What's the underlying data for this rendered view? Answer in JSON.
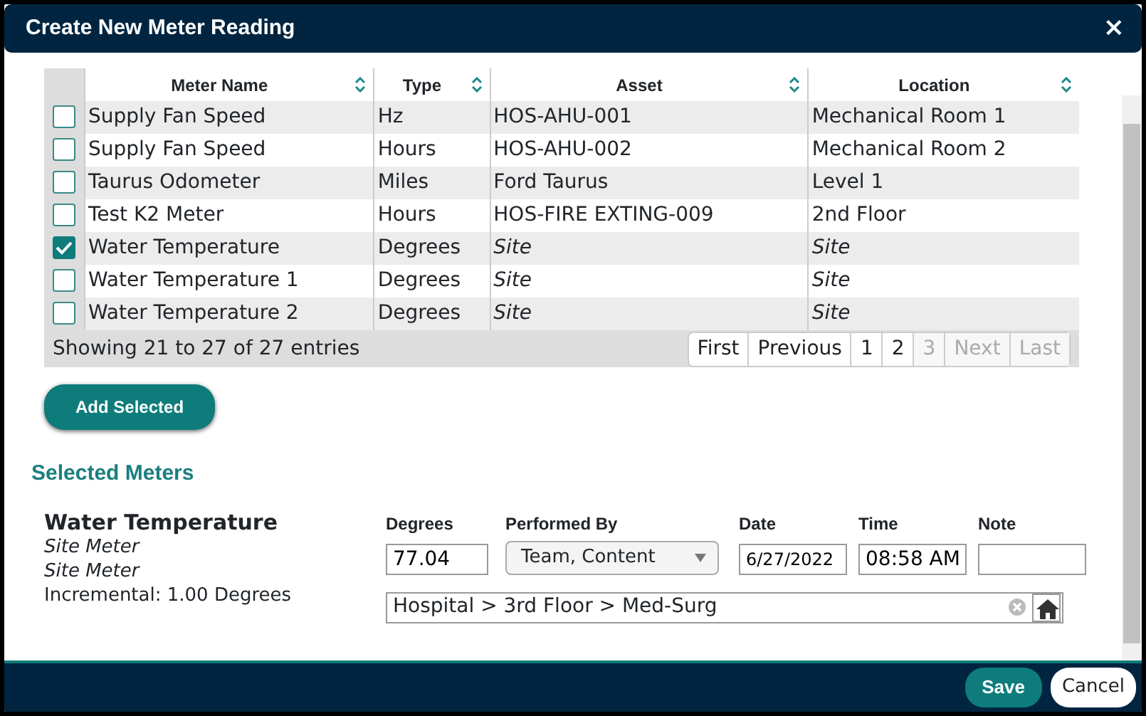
{
  "window": {
    "title": "Create New Meter Reading",
    "close": "×"
  },
  "table": {
    "columns": [
      "Meter Name",
      "Type",
      "Asset",
      "Location"
    ],
    "rows": [
      {
        "checked": false,
        "kind": "asset",
        "cells": [
          "Supply Fan Speed",
          "Hz",
          "HOS-AHU-001",
          "Mechanical Room 1"
        ]
      },
      {
        "checked": false,
        "kind": "asset",
        "cells": [
          "Supply Fan Speed",
          "Hours",
          "HOS-AHU-002",
          "Mechanical Room 2"
        ]
      },
      {
        "checked": false,
        "kind": "asset",
        "cells": [
          "Taurus Odometer",
          "Miles",
          "Ford Taurus",
          "Level 1"
        ]
      },
      {
        "checked": false,
        "kind": "asset",
        "cells": [
          "Test K2 Meter",
          "Hours",
          "HOS-FIRE EXTING-009",
          "2nd Floor"
        ]
      },
      {
        "checked": true,
        "kind": "site",
        "cells": [
          "Water Temperature",
          "Degrees",
          "Site",
          "Site"
        ]
      },
      {
        "checked": false,
        "kind": "site",
        "cells": [
          "Water Temperature 1",
          "Degrees",
          "Site",
          "Site"
        ]
      },
      {
        "checked": false,
        "kind": "site",
        "cells": [
          "Water Temperature 2",
          "Degrees",
          "Site",
          "Site"
        ]
      }
    ],
    "info": "Showing 21 to 27 of 27 entries",
    "pages": [
      {
        "label": "First",
        "disabled": false
      },
      {
        "label": "Previous",
        "disabled": false
      },
      {
        "label": "1",
        "disabled": false
      },
      {
        "label": "2",
        "disabled": false
      },
      {
        "label": "3",
        "disabled": true
      },
      {
        "label": "Next",
        "disabled": true
      },
      {
        "label": "Last",
        "disabled": true
      }
    ]
  },
  "add_button": "Add Selected",
  "selected_meters": {
    "heading": "Selected Meters",
    "meter": {
      "name": "Water Temperature",
      "lines": [
        "Site Meter",
        "Site Meter"
      ],
      "incremental": "Incremental: 1.00 Degrees"
    },
    "fields": {
      "degrees": {
        "label": "Degrees",
        "value": "77.04"
      },
      "performed_by": {
        "label": "Performed By",
        "value": "Team, Content"
      },
      "date": {
        "label": "Date",
        "value": "6/27/2022"
      },
      "time": {
        "label": "Time",
        "value": "08:58 AM"
      },
      "note": {
        "label": "Note"
      }
    },
    "location": "Hospital > 3rd Floor > Med-Surg"
  },
  "buttons": {
    "save": "Save",
    "cancel": "Cancel"
  }
}
